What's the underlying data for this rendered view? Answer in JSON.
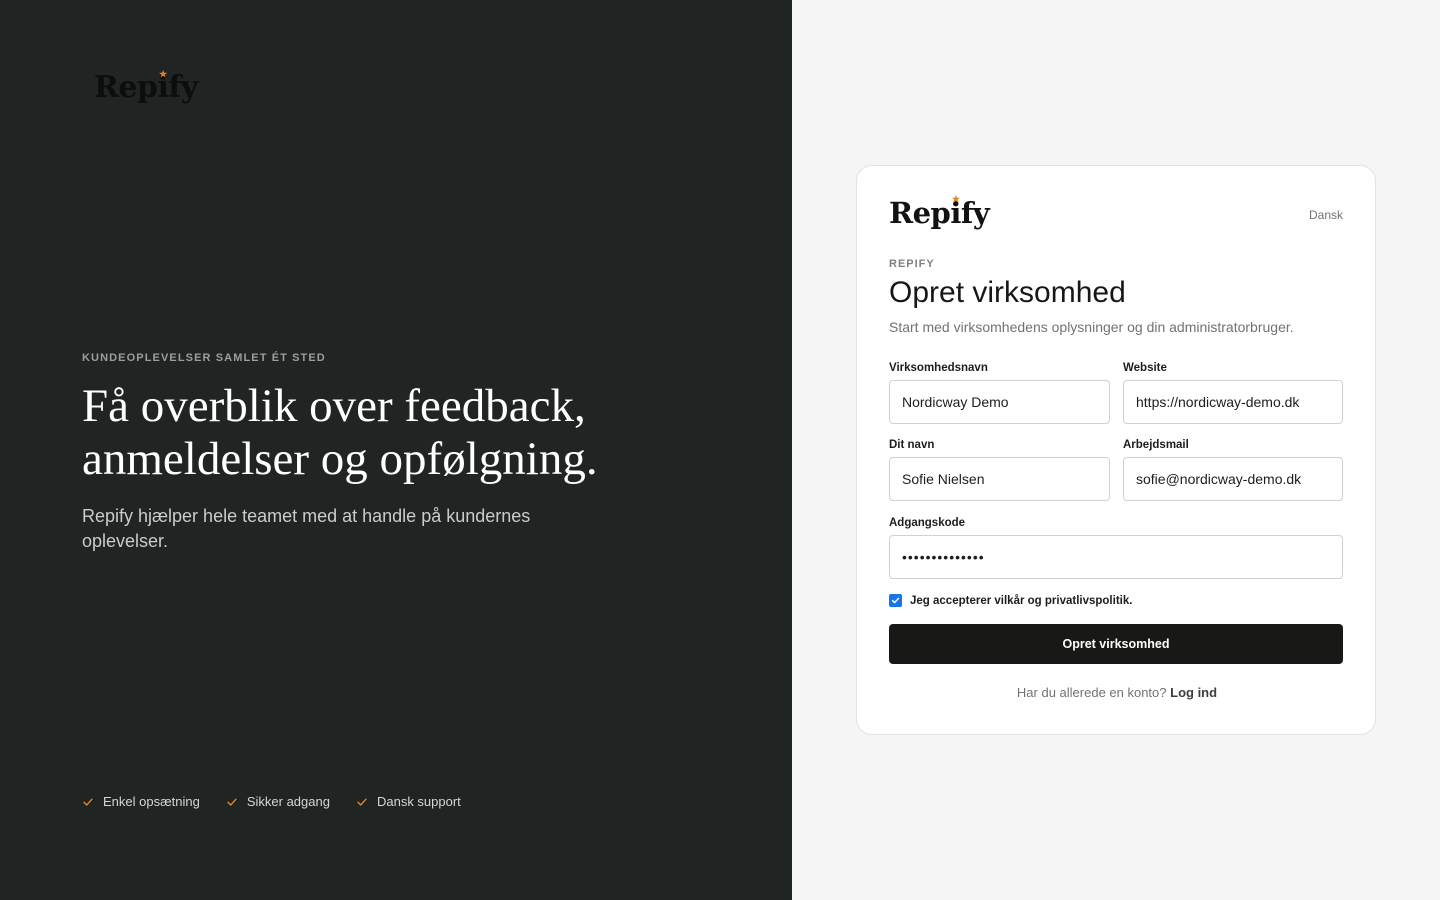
{
  "brand": {
    "name_part1": "Rep",
    "name_i": "i",
    "name_part2": "fy",
    "star": "★",
    "accent": "#e8831f"
  },
  "left": {
    "eyebrow": "KUNDEOPLEVELSER SAMLET ÉT STED",
    "hero_line1": "Få overblik over feedback,",
    "hero_line2": "anmeldelser og opfølgning.",
    "lead": "Repify hjælper hele teamet med at handle på kundernes oplevelser.",
    "features": [
      {
        "label": "Enkel opsætning",
        "icon": "check-icon"
      },
      {
        "label": "Sikker adgang",
        "icon": "check-icon"
      },
      {
        "label": "Dansk support",
        "icon": "check-icon"
      }
    ]
  },
  "card": {
    "language": "Dansk",
    "eyebrow": "REPIFY",
    "title": "Opret virksomhed",
    "subtitle": "Start med virksomhedens oplysninger og din administratorbruger.",
    "fields": {
      "company": {
        "label": "Virksomhedsnavn",
        "value": "Nordicway Demo"
      },
      "website": {
        "label": "Website",
        "value": "https://nordicway-demo.dk"
      },
      "name": {
        "label": "Dit navn",
        "value": "Sofie Nielsen"
      },
      "email": {
        "label": "Arbejdsmail",
        "value": "sofie@nordicway-demo.dk"
      },
      "password": {
        "label": "Adgangskode",
        "value": "••••••••••••••"
      }
    },
    "terms_label": "Jeg accepterer vilkår og privatlivspolitik.",
    "terms_checked": true,
    "submit_label": "Opret virksomhed",
    "login_prompt": "Har du allerede en konto?",
    "login_link": "Log ind"
  }
}
